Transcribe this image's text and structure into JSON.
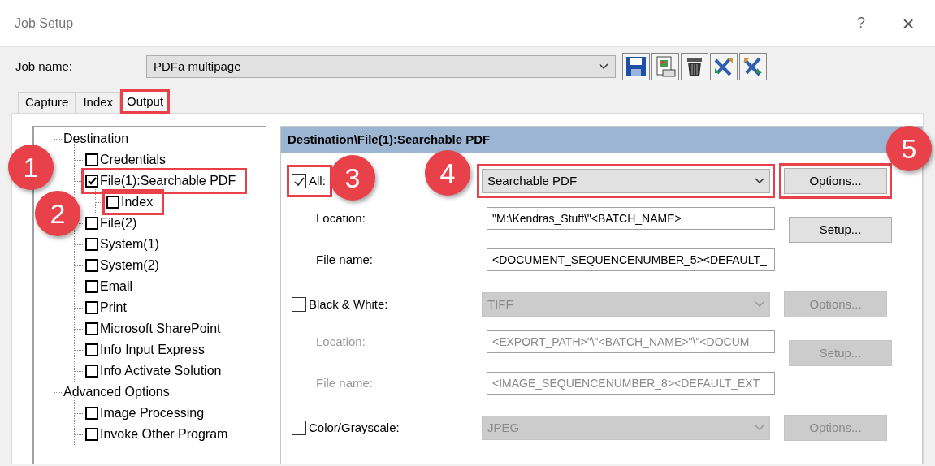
{
  "window": {
    "title": "Job Setup",
    "help_button": "?",
    "close_button": "×"
  },
  "job_name": {
    "label": "Job name:",
    "value": "PDFa multipage"
  },
  "tabs": [
    {
      "label": "Capture",
      "selected": false,
      "highlighted": false
    },
    {
      "label": "Index",
      "selected": false,
      "highlighted": false
    },
    {
      "label": "Output",
      "selected": true,
      "highlighted": true
    }
  ],
  "tree": [
    {
      "label": "Destination",
      "children": [
        {
          "label": "Credentials",
          "checked": false,
          "highlighted": false
        },
        {
          "label": "File(1):Searchable PDF",
          "checked": true,
          "highlighted": true,
          "children": [
            {
              "label": "Index",
              "checked": false,
              "highlighted": true
            }
          ]
        },
        {
          "label": "File(2)",
          "checked": false,
          "highlighted": false
        },
        {
          "label": "System(1)",
          "checked": false,
          "highlighted": false
        },
        {
          "label": "System(2)",
          "checked": false,
          "highlighted": false
        },
        {
          "label": "Email",
          "checked": false,
          "highlighted": false
        },
        {
          "label": "Print",
          "checked": false,
          "highlighted": false
        },
        {
          "label": "Microsoft SharePoint",
          "checked": false,
          "highlighted": false
        },
        {
          "label": "Info Input Express",
          "checked": false,
          "highlighted": false
        },
        {
          "label": "Info Activate Solution",
          "checked": false,
          "highlighted": false
        }
      ]
    },
    {
      "label": "Advanced Options",
      "children": [
        {
          "label": "Image Processing",
          "checked": false,
          "highlighted": false
        },
        {
          "label": "Invoke Other Program",
          "checked": false,
          "highlighted": false
        }
      ]
    }
  ],
  "panel": {
    "title": "Destination\\File(1):Searchable PDF",
    "sections": [
      {
        "label": "All:",
        "checked": true,
        "highlighted": true,
        "disabled": false,
        "format": "Searchable PDF",
        "format_highlighted": true,
        "options_button": "Options...",
        "options_highlighted": true,
        "location_label": "Location:",
        "location": "\"M:\\Kendras_Stuff\\\"<BATCH_NAME>",
        "setup_button": "Setup...",
        "file_name_label": "File name:",
        "file_name": "<DOCUMENT_SEQUENCENUMBER_5><DEFAULT_"
      },
      {
        "label": "Black & White:",
        "checked": false,
        "highlighted": false,
        "disabled": true,
        "format": "TIFF",
        "format_highlighted": false,
        "options_button": "Options...",
        "options_highlighted": false,
        "location_label": "Location:",
        "location": "<EXPORT_PATH>\"\\\"<BATCH_NAME>\"\\\"<DOCUM",
        "setup_button": "Setup...",
        "file_name_label": "File name:",
        "file_name": "<IMAGE_SEQUENCENUMBER_8><DEFAULT_EXT"
      },
      {
        "label": "Color/Grayscale:",
        "checked": false,
        "highlighted": false,
        "disabled": true,
        "format": "JPEG",
        "format_highlighted": false,
        "options_button": "Options...",
        "options_highlighted": false
      }
    ]
  },
  "callouts": [
    {
      "number": "1"
    },
    {
      "number": "2"
    },
    {
      "number": "3"
    },
    {
      "number": "4"
    },
    {
      "number": "5"
    }
  ]
}
